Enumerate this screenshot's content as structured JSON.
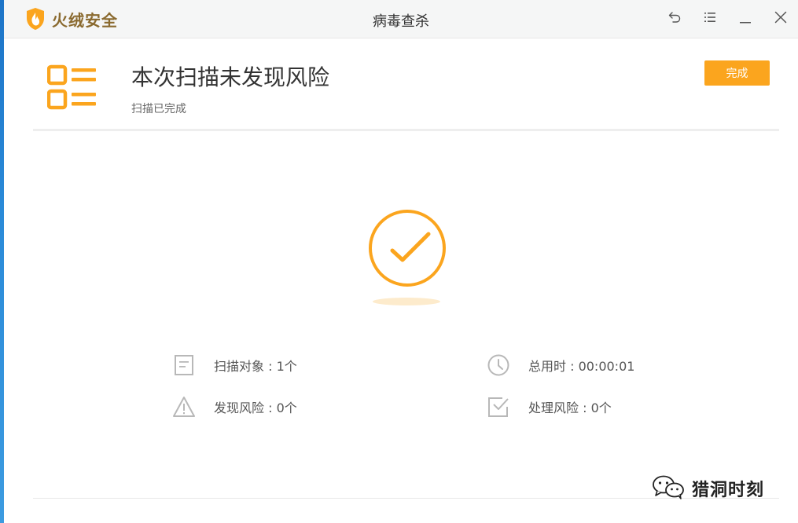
{
  "app": {
    "brand_name": "火绒安全",
    "window_title": "病毒查杀"
  },
  "header": {
    "title": "本次扫描未发现风险",
    "subtitle": "扫描已完成",
    "done_label": "完成"
  },
  "stats": {
    "scan_objects": "扫描对象 : 1个",
    "total_time": "总用时 : 00:00:01",
    "risks_found": "发现风险 : 0个",
    "risks_handled": "处理风险 : 0个"
  },
  "watermark": {
    "text": "猎洞时刻"
  },
  "colors": {
    "accent": "#fba51e",
    "title_text": "#333333",
    "stat_text": "#555555",
    "stat_icon": "#b8b8b8"
  },
  "icons": {
    "brand": "huorong-flame-shield-icon",
    "back": "undo-arrow-icon",
    "menu": "menu-list-icon",
    "minimize": "minimize-icon",
    "close": "close-icon",
    "header": "list-grid-icon",
    "result": "check-circle-icon",
    "scan_objects": "document-icon",
    "total_time": "clock-icon",
    "risks_found": "warning-triangle-icon",
    "risks_handled": "checked-box-icon",
    "watermark": "wechat-icon"
  }
}
